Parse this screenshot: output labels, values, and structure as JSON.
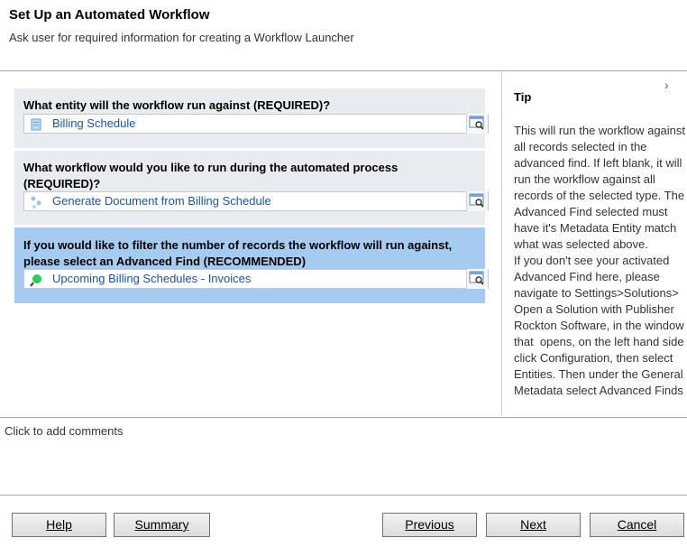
{
  "header": {
    "title": "Set Up an Automated Workflow",
    "subtitle": "Ask user for required information for creating a Workflow Launcher"
  },
  "questions": [
    {
      "label": "What entity will the workflow run against (REQUIRED)?",
      "value": "Billing Schedule",
      "icon": "entity-icon"
    },
    {
      "label": "What workflow would you like to run during the automated process (REQUIRED)?",
      "value": "Generate Document from Billing Schedule",
      "icon": "workflow-icon"
    },
    {
      "label": "If you would like to filter the number of records the workflow will run against, please select an Advanced Find (RECOMMENDED)",
      "value": "Upcoming Billing Schedules - Invoices",
      "icon": "advanced-find-icon"
    }
  ],
  "tip": {
    "title": "Tip",
    "body": "This will run the workflow against all records selected in the advanced find. If left blank, it will run the workflow against all records of the selected type. The Advanced Find selected must have it's Metadata Entity match what was selected above.\nIf you don't see your activated Advanced Find here, please navigate to Settings>Solutions> Open a Solution with Publisher Rockton Software, in the window that  opens, on the left hand side click Configuration, then select Entities. Then under the General Metadata select Advanced Finds"
  },
  "comments": {
    "placeholder": "Click to add comments"
  },
  "buttons": {
    "help": "Help",
    "summary": "Summary",
    "previous": "Previous",
    "next": "Next",
    "cancel": "Cancel"
  },
  "colors": {
    "selected_panel": "#a6cbf0",
    "panel": "#e8ebef",
    "link_text": "#1c55a2"
  }
}
